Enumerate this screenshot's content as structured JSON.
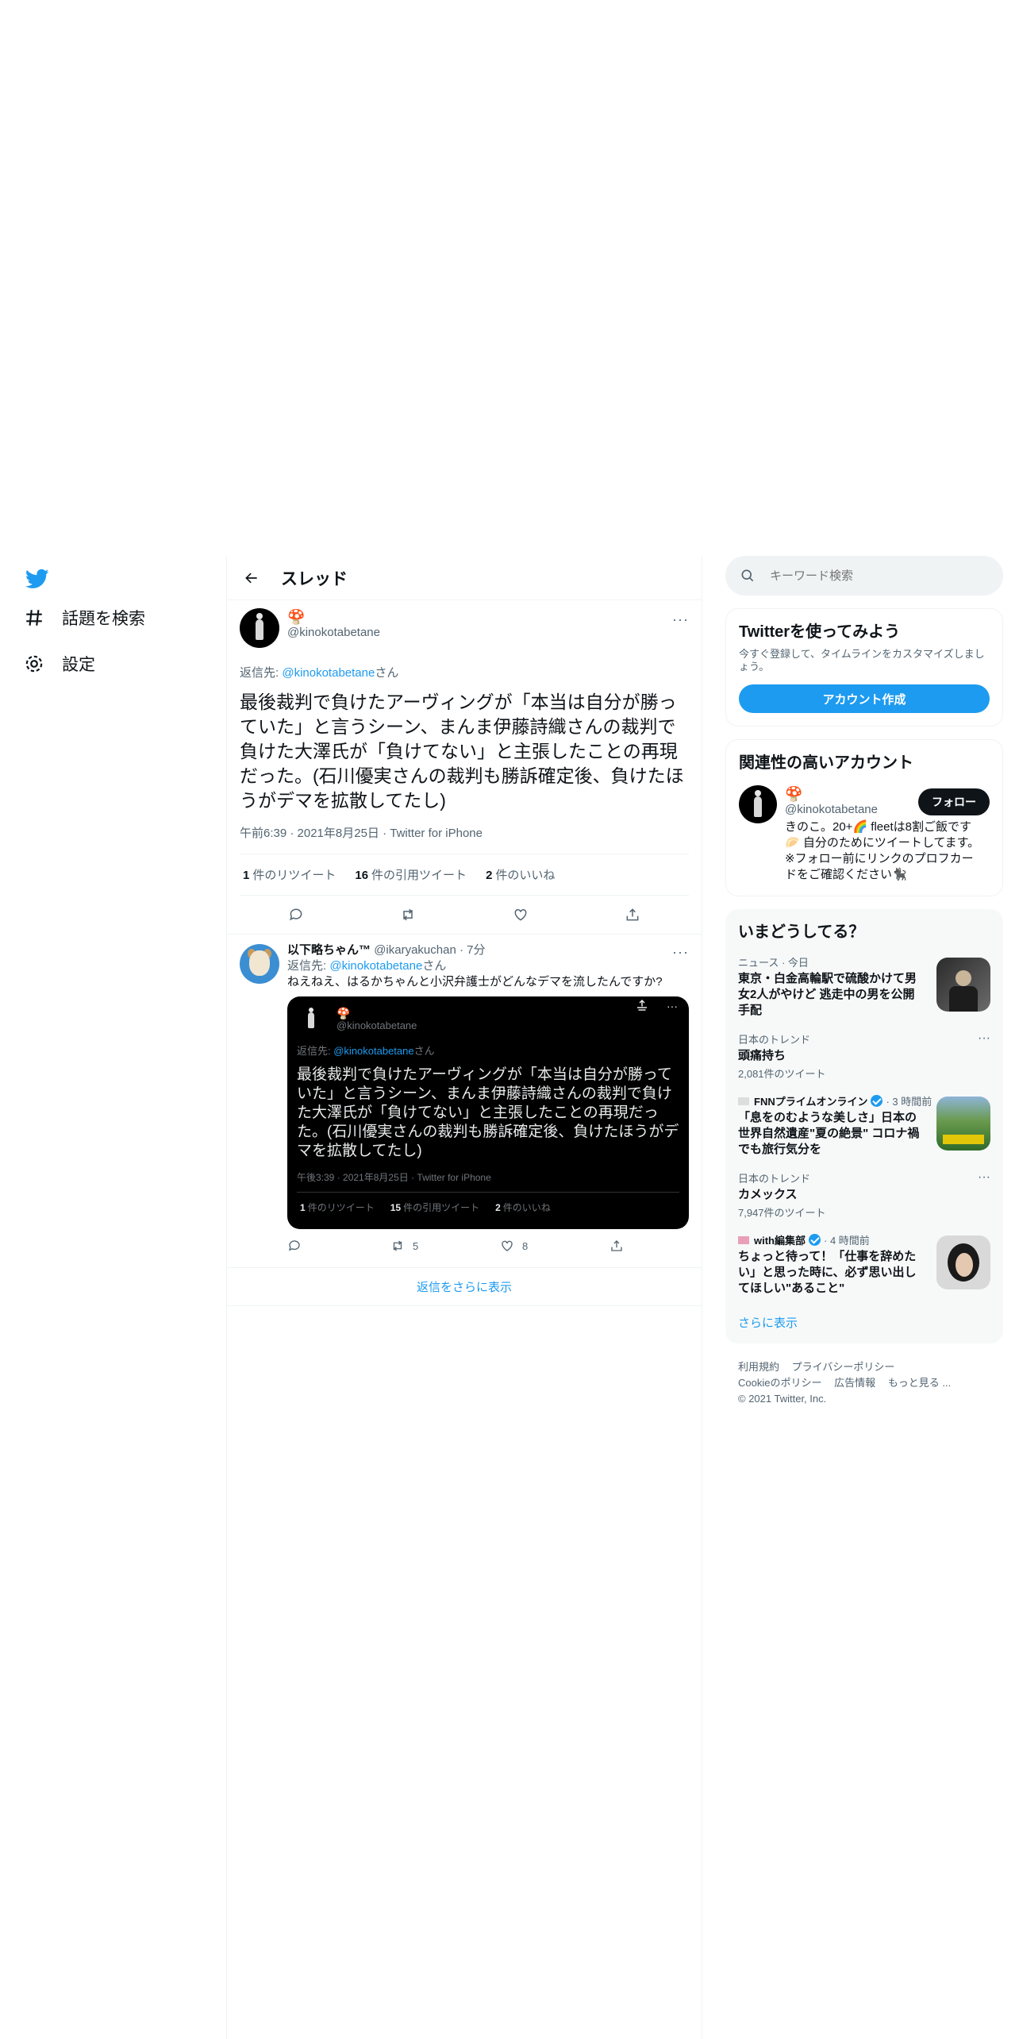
{
  "nav": {
    "items": [
      {
        "label": "話題を検索"
      },
      {
        "label": "設定"
      }
    ]
  },
  "header": {
    "title": "スレッド"
  },
  "main_tweet": {
    "display_name": "🍄",
    "handle": "@kinokotabetane",
    "reply_prefix": "返信先: ",
    "reply_handle": "@kinokotabetane",
    "reply_suffix": "さん",
    "text": "最後裁判で負けたアーヴィングが「本当は自分が勝っていた」と言うシーン、まんま伊藤詩織さんの裁判で負けた大澤氏が「負けてない」と主張したことの再現だった。(石川優実さんの裁判も勝訴確定後、負けたほうがデマを拡散してたし)",
    "timestamp": "午前6:39 · 2021年8月25日 · Twitter for iPhone",
    "retweets_count": "1",
    "retweets_label": "件のリツイート",
    "quotes_count": "16",
    "quotes_label": "件の引用ツイート",
    "likes_count": "2",
    "likes_label": "件のいいね"
  },
  "reply": {
    "name": "以下略ちゃん™",
    "handle_time": "@ikaryakuchan · 7分",
    "reply_prefix": "返信先: ",
    "reply_handle": "@kinokotabetane",
    "reply_suffix": "さん",
    "text": "ねえねえ、はるかちゃんと小沢弁護士がどんなデマを流したんですか?",
    "retweet_count": "5",
    "like_count": "8",
    "quote": {
      "display_name": "🍄",
      "handle": "@kinokotabetane",
      "reply_prefix": "返信先: ",
      "reply_handle": "@kinokotabetane",
      "reply_suffix": "さん",
      "text": "最後裁判で負けたアーヴィングが「本当は自分が勝っていた」と言うシーン、まんま伊藤詩織さんの裁判で負けた大澤氏が「負けてない」と主張したことの再現だった。(石川優実さんの裁判も勝訴確定後、負けたほうがデマを拡散してたし)",
      "timestamp": "午後3:39 · 2021年8月25日 · Twitter for iPhone",
      "retweets_count": "1",
      "retweets_label": "件のリツイート",
      "quotes_count": "15",
      "quotes_label": "件の引用ツイート",
      "likes_count": "2",
      "likes_label": "件のいいね"
    }
  },
  "show_more_replies": "返信をさらに表示",
  "search": {
    "placeholder": "キーワード検索"
  },
  "signup_card": {
    "title": "Twitterを使ってみよう",
    "desc": "今すぐ登録して、タイムラインをカスタマイズしましょう。",
    "button": "アカウント作成"
  },
  "related": {
    "title": "関連性の高いアカウント",
    "account": {
      "display_name": "🍄",
      "handle": "@kinokotabetane",
      "follow": "フォロー",
      "bio": "きのこ。20+🌈 fleetは8割ご飯です🥟 自分のためにツイートしてます。※フォロー前にリンクのプロフカードをご確認ください🐈‍⬛"
    }
  },
  "trends": {
    "title": "いまどうしてる？",
    "items": [
      {
        "category": "ニュース · 今日",
        "headline": "東京・白金高輪駅で硫酸かけて男女2人がやけど 逃走中の男を公開手配"
      },
      {
        "category": "日本のトレンド",
        "headline": "頭痛持ち",
        "count": "2,081件のツイート"
      },
      {
        "source": "FNNプライムオンライン",
        "time": "· 3 時間前",
        "headline": "「息をのむような美しさ」日本の世界自然遺産\"夏の絶景\" コロナ禍でも旅行気分を"
      },
      {
        "category": "日本のトレンド",
        "headline": "カメックス",
        "count": "7,947件のツイート"
      },
      {
        "source": "with編集部",
        "time": "· 4 時間前",
        "headline": "ちょっと待って！「仕事を辞めたい」と思った時に、必ず思い出してほしい\"あること\""
      }
    ],
    "more": "さらに表示"
  },
  "footer": {
    "terms": "利用規約",
    "privacy": "プライバシーポリシー",
    "cookie": "Cookieのポリシー",
    "ads": "広告情報",
    "more": "もっと見る ...",
    "copyright": "© 2021 Twitter, Inc."
  },
  "colors": {
    "accent": "#1d9bf0",
    "text": "#0f1419",
    "muted": "#536471"
  }
}
